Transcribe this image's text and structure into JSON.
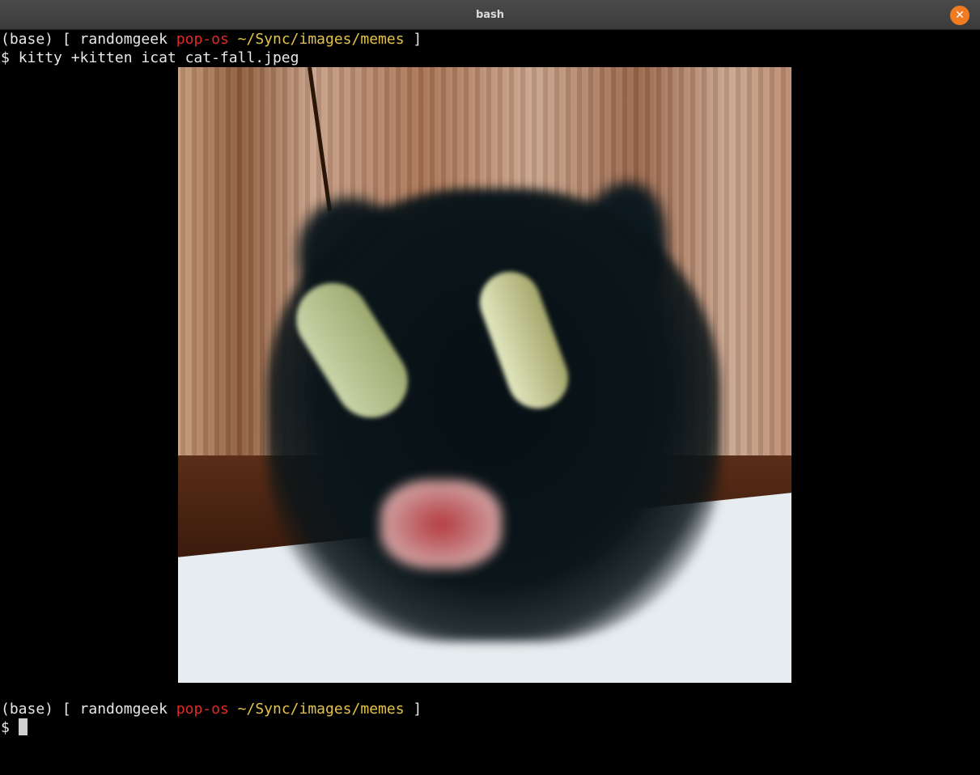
{
  "window": {
    "title": "bash",
    "close_glyph": "✕"
  },
  "terminal": {
    "prompt1": {
      "env": "(base)",
      "open": " [ ",
      "user": "randomgeek",
      "host": "pop-os",
      "path": "~/Sync/images/memes",
      "close": " ]"
    },
    "command_line": {
      "symbol": "$",
      "command": "kitty +kitten icat cat-fall.jpeg"
    },
    "image": {
      "file": "cat-fall.jpeg",
      "description_icon": "cat-image"
    },
    "prompt2": {
      "env": "(base)",
      "open": " [ ",
      "user": "randomgeek",
      "host": "pop-os",
      "path": "~/Sync/images/memes",
      "close": " ]"
    },
    "input_line": {
      "symbol": "$",
      "value": ""
    }
  },
  "colors": {
    "host": "#e12a26",
    "path": "#e3c34c",
    "close_button": "#f07b21",
    "background": "#000000"
  }
}
